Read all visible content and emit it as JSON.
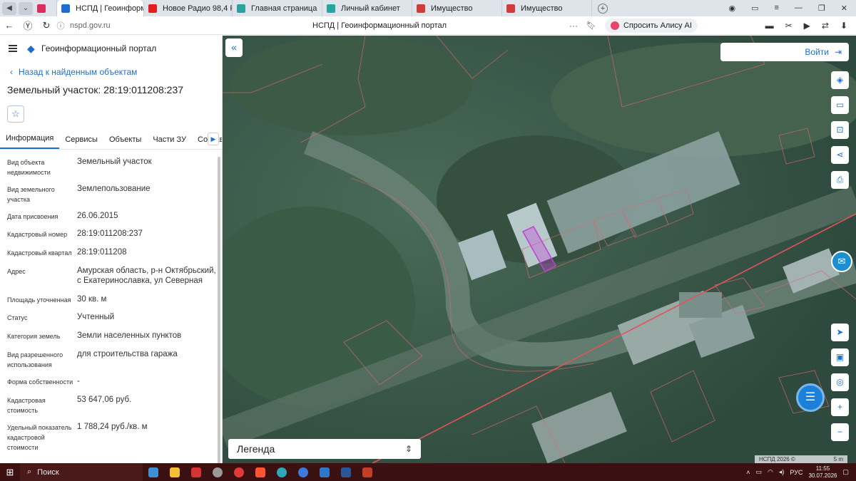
{
  "browser": {
    "tabs": [
      {
        "label": "",
        "icon": "pocket-icon",
        "color": "#d92e5c",
        "active": false
      },
      {
        "label": "НСПД | Геоинформаци",
        "icon": "nspd-icon",
        "color": "#1c6fd1",
        "active": true
      },
      {
        "label": "Новое Радио 98,4 F",
        "icon": "youtube-icon",
        "color": "#e41d1d",
        "active": false
      },
      {
        "label": "Главная страница",
        "icon": "shield-icon",
        "color": "#2aa3a0",
        "active": false
      },
      {
        "label": "Личный кабинет",
        "icon": "shield-icon",
        "color": "#2aa3a0",
        "active": false
      },
      {
        "label": "Имущество",
        "icon": "ptc-icon",
        "color": "#d33a3a",
        "active": false
      },
      {
        "label": "Имущество",
        "icon": "ptc-icon",
        "color": "#d33a3a",
        "active": false
      }
    ],
    "url": "nspd.gov.ru",
    "page_title": "НСПД | Геоинформационный портал",
    "alisa_label": "Спросить Алису AI"
  },
  "panel": {
    "portal_name": "Геоинформационный портал",
    "back_link": "Назад к найденным объектам",
    "object_title": "Земельный участок: 28:19:011208:237",
    "tabs": [
      "Информация",
      "Сервисы",
      "Объекты",
      "Части ЗУ",
      "Состав"
    ],
    "properties": [
      {
        "label": "Вид объекта недвижимости",
        "value": "Земельный участок"
      },
      {
        "label": "Вид земельного участка",
        "value": "Землепользование"
      },
      {
        "label": "Дата присвоения",
        "value": "26.06.2015"
      },
      {
        "label": "Кадастровый номер",
        "value": "28:19:011208:237"
      },
      {
        "label": "Кадастровый квартал",
        "value": "28:19:011208"
      },
      {
        "label": "Адрес",
        "value": "Амурская область, р-н Октябрьский, с Екатеринославка, ул Северная"
      },
      {
        "label": "Площадь уточненная",
        "value": "30 кв. м"
      },
      {
        "label": "Статус",
        "value": "Учтенный"
      },
      {
        "label": "Категория земель",
        "value": "Земли населенных пунктов"
      },
      {
        "label": "Вид разрешенного использования",
        "value": "для строительства гаража"
      },
      {
        "label": "Форма собственности",
        "value": "-"
      },
      {
        "label": "Кадастровая стоимость",
        "value": "53 647,06 руб."
      },
      {
        "label": "Удельный показатель кадастровой стоимости",
        "value": "1 788,24 руб./кв. м"
      }
    ]
  },
  "map": {
    "login_label": "Войти",
    "legend_label": "Легенда",
    "scale_copyright": "НСПД 2026 ©",
    "scale_label": "5 m",
    "tools": [
      "layers-icon",
      "ruler-icon",
      "area-select-icon",
      "share-icon",
      "print-icon"
    ],
    "nav_tools": [
      "locate-icon",
      "minimap-icon",
      "geotag-icon",
      "zoom-in-icon",
      "zoom-out-icon"
    ]
  },
  "taskbar": {
    "search_label": "Поиск",
    "lang": "РУС",
    "time": "11:55",
    "date": "30.07.2026"
  },
  "colors": {
    "accent": "#1c6fd1",
    "parcel_highlight": "#c23fd8",
    "boundary": "#e0545a"
  }
}
